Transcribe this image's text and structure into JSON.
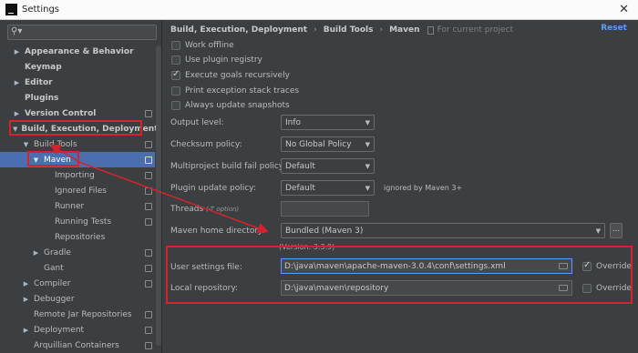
{
  "window": {
    "title": "Settings"
  },
  "search": {
    "placeholder": ""
  },
  "sidebar": {
    "items": [
      {
        "label": "Appearance & Behavior",
        "arrow": "▶"
      },
      {
        "label": "Keymap"
      },
      {
        "label": "Editor",
        "arrow": "▶"
      },
      {
        "label": "Plugins"
      },
      {
        "label": "Version Control",
        "arrow": "▶"
      },
      {
        "label": "Build, Execution, Deployment",
        "arrow": "▼"
      },
      {
        "label": "Build Tools",
        "arrow": "▼"
      },
      {
        "label": "Maven",
        "arrow": "▼"
      },
      {
        "label": "Importing"
      },
      {
        "label": "Ignored Files"
      },
      {
        "label": "Runner"
      },
      {
        "label": "Running Tests"
      },
      {
        "label": "Repositories"
      },
      {
        "label": "Gradle",
        "arrow": "▶"
      },
      {
        "label": "Gant"
      },
      {
        "label": "Compiler",
        "arrow": "▶"
      },
      {
        "label": "Debugger",
        "arrow": "▶"
      },
      {
        "label": "Remote Jar Repositories"
      },
      {
        "label": "Deployment",
        "arrow": "▶"
      },
      {
        "label": "Arquillian Containers"
      }
    ]
  },
  "header": {
    "crumb1": "Build, Execution, Deployment",
    "crumb2": "Build Tools",
    "crumb3": "Maven",
    "separator": "›",
    "for_current_project": "For current project",
    "reset": "Reset"
  },
  "options": {
    "work_offline": "Work offline",
    "use_plugin_registry": "Use plugin registry",
    "execute_goals_recursively": "Execute goals recursively",
    "print_exception": "Print exception stack traces",
    "always_update_snapshots": "Always update snapshots"
  },
  "form": {
    "output_level_label": "Output level:",
    "output_level_value": "Info",
    "checksum_label": "Checksum policy:",
    "checksum_value": "No Global Policy",
    "multiproject_label": "Multiproject build fail policy:",
    "multiproject_value": "Default",
    "plugin_update_label": "Plugin update policy:",
    "plugin_update_value": "Default",
    "plugin_update_note": "ignored by Maven 3+",
    "threads_label": "Threads",
    "threads_hint": "(-T option)",
    "maven_home_label": "Maven home directory:",
    "maven_home_value": "Bundled (Maven 3)",
    "dots": "...",
    "version": "(Version: 3.3.9)",
    "user_settings_label": "User settings file:",
    "user_settings_value": "D:\\java\\maven\\apache-maven-3.0.4\\conf\\settings.xml",
    "local_repo_label": "Local repository:",
    "local_repo_value": "D:\\java\\maven\\repository",
    "override": "Override"
  },
  "colors": {
    "accent": "#4b6eaf",
    "annotation": "#d4232d",
    "link": "#589df6"
  }
}
